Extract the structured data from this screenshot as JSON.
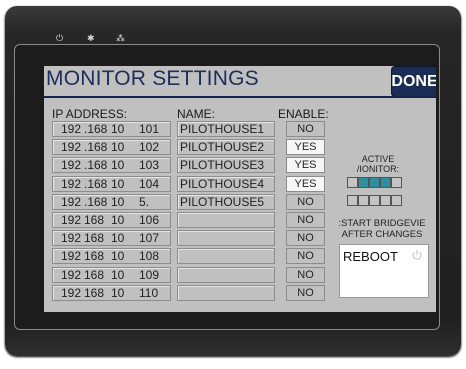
{
  "window": {
    "title": "MONITOR SETTINGS",
    "done_label": "DONE"
  },
  "headers": {
    "ip": "IP ADDRESS:",
    "name": "NAME:",
    "enable": "ENABLE:"
  },
  "rows": [
    {
      "ip": [
        "192",
        ".168",
        "10",
        "101"
      ],
      "name": "PILOTHOUSE1",
      "enable": "NO"
    },
    {
      "ip": [
        "192",
        ".168",
        "10",
        "102"
      ],
      "name": "PILOTHOUSE2",
      "enable": "YES"
    },
    {
      "ip": [
        "192",
        ".168",
        "10",
        "103"
      ],
      "name": "PILOTHOUSE3",
      "enable": "YES"
    },
    {
      "ip": [
        "192",
        ".168",
        "10",
        "104"
      ],
      "name": "PILOTHOUSE4",
      "enable": "YES"
    },
    {
      "ip": [
        "192",
        ".168",
        "10",
        "5."
      ],
      "name": "PILOTHOUSE5",
      "enable": "NO"
    },
    {
      "ip": [
        "192",
        "168",
        "10",
        "106"
      ],
      "name": "",
      "enable": "NO"
    },
    {
      "ip": [
        "192",
        "168",
        "10",
        "107"
      ],
      "name": "",
      "enable": "NO"
    },
    {
      "ip": [
        "192",
        "168",
        "10",
        "108"
      ],
      "name": "",
      "enable": "NO"
    },
    {
      "ip": [
        "192",
        "168",
        "10",
        "109"
      ],
      "name": "",
      "enable": "NO"
    },
    {
      "ip": [
        "192",
        "168",
        "10",
        "110"
      ],
      "name": "",
      "enable": "NO"
    }
  ],
  "active_monitors": {
    "label_line1": "ACTIVE",
    "label_line2": "/IONITOR:",
    "states": [
      false,
      true,
      true,
      true,
      false,
      false,
      false,
      false,
      false,
      false
    ]
  },
  "reboot": {
    "label_line1": ":START BRIDGEVIE",
    "label_line2": "AFTER CHANGES",
    "button_label": "REBOOT"
  },
  "colors": {
    "title": "#1e2e5a",
    "done_bg": "#1b2c55",
    "panel": "#c0c0c0",
    "active_on": "#2f8fa0"
  },
  "icons": {
    "status_leds": [
      "power-icon",
      "sun-icon",
      "network-icon"
    ],
    "reboot": "power-icon"
  }
}
